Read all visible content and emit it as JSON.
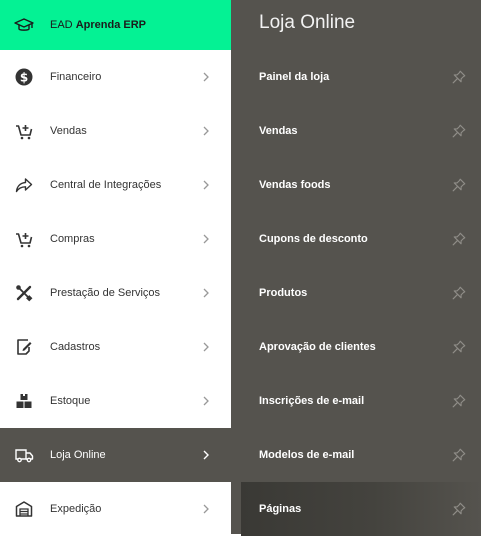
{
  "sidebar": {
    "ead": {
      "prefix": "EAD",
      "brand": "Aprenda ERP",
      "icon": "graduation-cap-icon",
      "color": "#04f294"
    },
    "items": [
      {
        "label": "Financeiro",
        "icon": "dollar-icon"
      },
      {
        "label": "Vendas",
        "icon": "cart-add-icon"
      },
      {
        "label": "Central de Integrações",
        "icon": "share-arrow-icon"
      },
      {
        "label": "Compras",
        "icon": "cart-add-icon"
      },
      {
        "label": "Prestação de Serviços",
        "icon": "tools-icon"
      },
      {
        "label": "Cadastros",
        "icon": "edit-note-icon"
      },
      {
        "label": "Estoque",
        "icon": "boxes-icon"
      },
      {
        "label": "Loja Online",
        "icon": "delivery-truck-icon",
        "active": true
      },
      {
        "label": "Expedição",
        "icon": "warehouse-icon"
      }
    ]
  },
  "submenu": {
    "title": "Loja Online",
    "items": [
      {
        "label": "Painel da loja"
      },
      {
        "label": "Vendas"
      },
      {
        "label": "Vendas foods"
      },
      {
        "label": "Cupons de desconto"
      },
      {
        "label": "Produtos"
      },
      {
        "label": "Aprovação de clientes"
      },
      {
        "label": "Inscrições de e-mail"
      },
      {
        "label": "Modelos de e-mail"
      },
      {
        "label": "Páginas",
        "hovered": true
      }
    ]
  },
  "colors": {
    "panel": "#55534e",
    "accent": "#04f294",
    "text": "#333333"
  }
}
